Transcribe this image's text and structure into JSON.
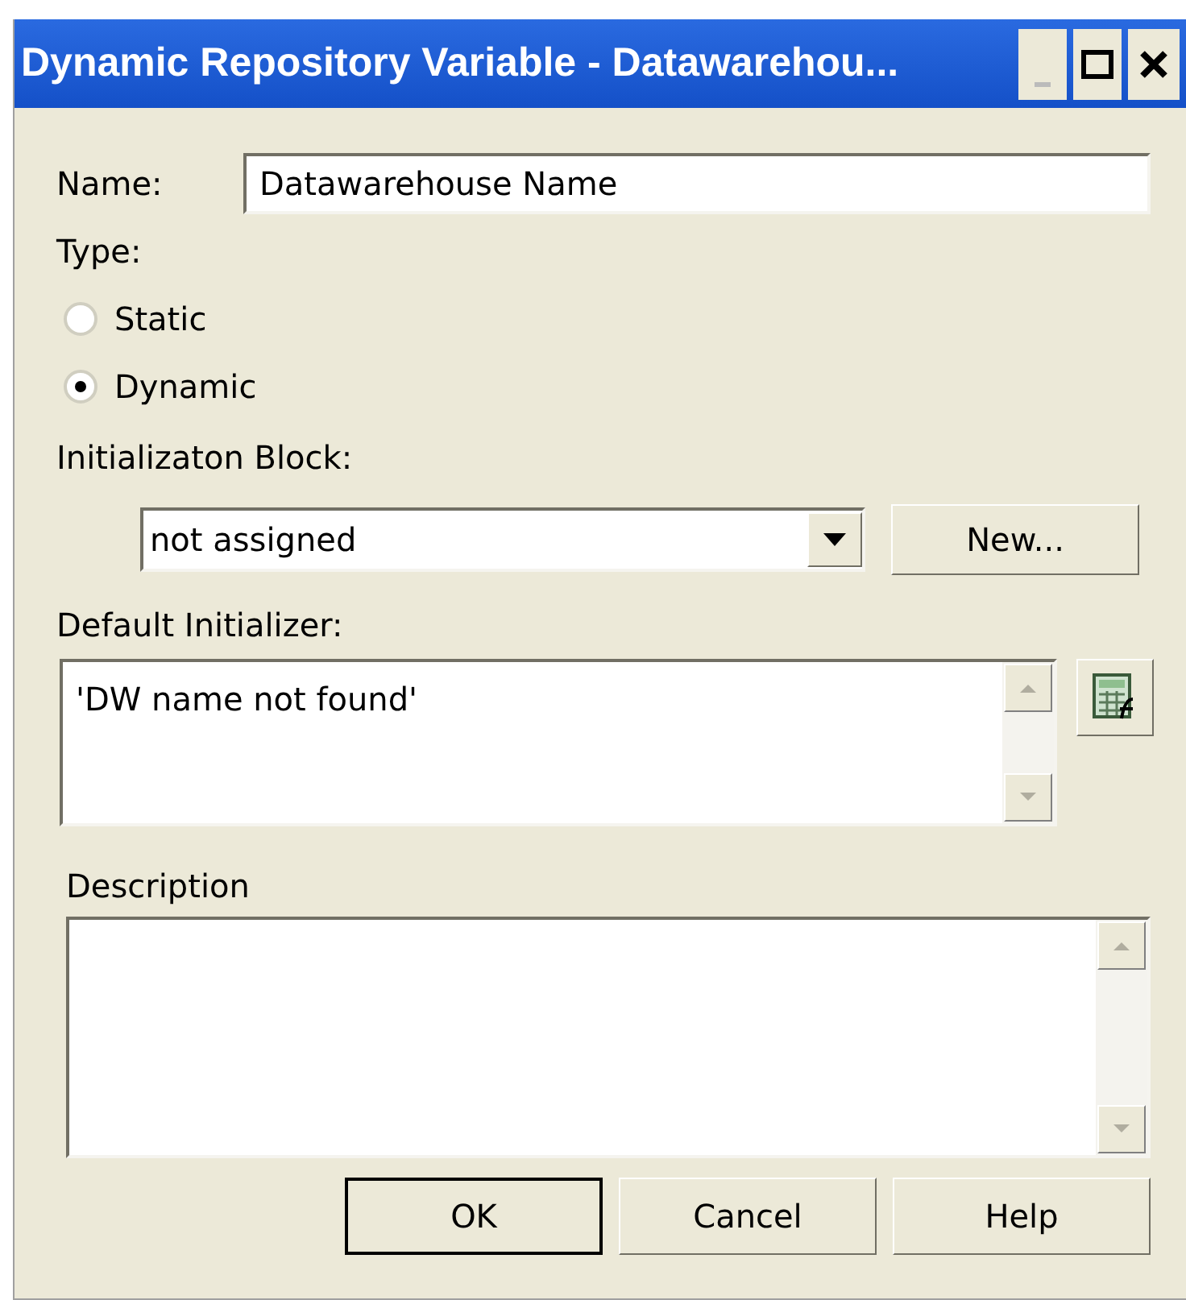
{
  "window": {
    "title": "Dynamic Repository Variable - Datawarehou..."
  },
  "name": {
    "label": "Name:",
    "value": "Datawarehouse Name"
  },
  "type": {
    "label": "Type:",
    "options": [
      {
        "label": "Static",
        "selected": false
      },
      {
        "label": "Dynamic",
        "selected": true
      }
    ]
  },
  "initialization_block": {
    "label": "Initializaton Block:",
    "value": "not assigned",
    "button": "New..."
  },
  "default_initializer": {
    "label": "Default Initializer:",
    "value": "'DW name not found'"
  },
  "description": {
    "label": "Description"
  },
  "buttons": [
    {
      "label": "OK",
      "default": true
    },
    {
      "label": "Cancel",
      "default": false
    },
    {
      "label": "Help",
      "default": false
    }
  ]
}
